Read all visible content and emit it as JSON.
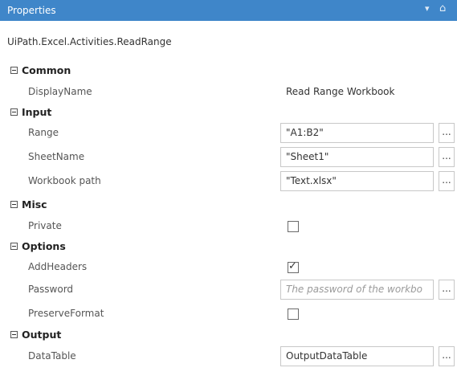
{
  "panel": {
    "title": "Properties",
    "activity_type": "UiPath.Excel.Activities.ReadRange"
  },
  "categories": {
    "common": {
      "label": "Common",
      "display_name": {
        "label": "DisplayName",
        "value": "Read Range Workbook"
      }
    },
    "input": {
      "label": "Input",
      "range": {
        "label": "Range",
        "value": "\"A1:B2\""
      },
      "sheet_name": {
        "label": "SheetName",
        "value": "\"Sheet1\""
      },
      "workbook_path": {
        "label": "Workbook path",
        "value": "\"Text.xlsx\""
      }
    },
    "misc": {
      "label": "Misc",
      "private": {
        "label": "Private",
        "checked": false
      }
    },
    "options": {
      "label": "Options",
      "add_headers": {
        "label": "AddHeaders",
        "checked": true
      },
      "password": {
        "label": "Password",
        "placeholder": "The password of the workbo"
      },
      "preserve_format": {
        "label": "PreserveFormat",
        "checked": false
      }
    },
    "output": {
      "label": "Output",
      "data_table": {
        "label": "DataTable",
        "value": "OutputDataTable"
      }
    }
  },
  "ellipsis_label": "...",
  "check_glyph": "✓",
  "colors": {
    "title_bar": "#3f86c9"
  }
}
